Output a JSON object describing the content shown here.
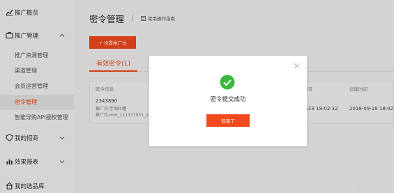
{
  "sidebar": {
    "overview": "推广概览",
    "promotion": "推广管理",
    "sub_items": [
      "推广资源管理",
      "渠道管理",
      "会员运营管理",
      "密令管理",
      "智能导购API授权管理"
    ],
    "recruit": "我的招商",
    "reports": "效果报表",
    "selection": "我的选品库",
    "icons": [
      "chart-icon",
      "briefcase-icon",
      "shield-icon",
      "bar-chart-icon",
      "home-icon"
    ]
  },
  "main": {
    "title": "密令管理",
    "guide": "使用操作指南",
    "set_button": "+ 设置推广位",
    "tab": "有效密令(1)",
    "table": {
      "headers": [
        "密令信息",
        "间",
        "创建时间"
      ],
      "row": {
        "code": "2343890",
        "line2": "推广页:手淘吐槽",
        "line3": "推广位:mm_111377051_1",
        "time1": "0-23 18:02:32",
        "time2": "2018-09-18 18:02:3"
      }
    }
  },
  "modal": {
    "message": "密令提交成功",
    "ok_button": "知道了"
  },
  "colors": {
    "accent": "#f24a1c",
    "success": "#3db83d"
  }
}
